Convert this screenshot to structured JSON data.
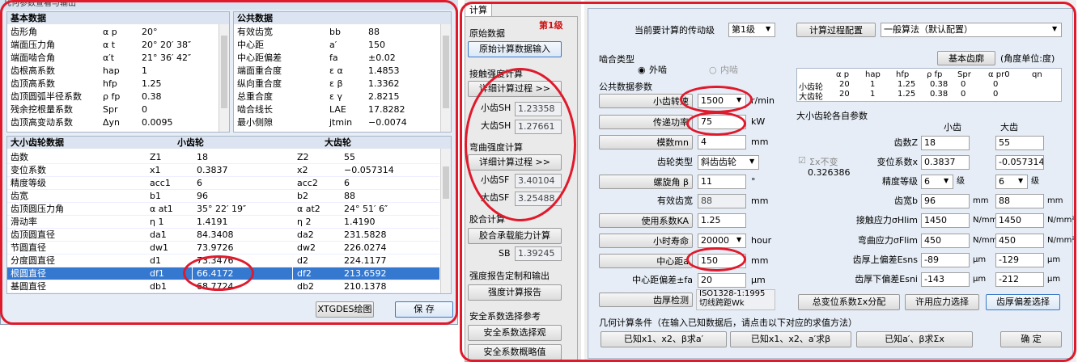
{
  "win1": {
    "title": "几何参数查看与输出",
    "basic_header": "基本数据",
    "public_header": "公共数据",
    "basic": [
      [
        "齿形角",
        "α p",
        "20°"
      ],
      [
        "端面压力角",
        "α t",
        "20° 20′ 38″"
      ],
      [
        "端面啮合角",
        "α′t",
        "21° 36′ 42″"
      ],
      [
        "齿根高系数",
        "hap",
        "1"
      ],
      [
        "齿顶高系数",
        "hfp",
        "1.25"
      ],
      [
        "齿顶圆弧半径系数",
        "ρ fp",
        "0.38"
      ],
      [
        "残余挖根量系数",
        "Spr",
        "0"
      ],
      [
        "齿顶高变动系数",
        "Δyn",
        "0.0095"
      ]
    ],
    "public": [
      [
        "有效齿宽",
        "bb",
        "88"
      ],
      [
        "中心距",
        "a′",
        "150"
      ],
      [
        "中心距偏差",
        "fa",
        "±0.02"
      ],
      [
        "端面重合度",
        "ε α",
        "1.4853"
      ],
      [
        "纵向重合度",
        "ε β",
        "1.3362"
      ],
      [
        "总重合度",
        "ε γ",
        "2.8215"
      ],
      [
        "啮合线长",
        "LAE",
        "17.8282"
      ],
      [
        "最小侧隙",
        "jtmin",
        "−0.0074"
      ]
    ],
    "gear_header": [
      "大小齿轮数据",
      "小齿轮",
      "大齿轮"
    ],
    "gears": [
      [
        "齿数",
        "Z1",
        "18",
        "Z2",
        "55"
      ],
      [
        "变位系数",
        "x1",
        "0.3837",
        "x2",
        "−0.057314"
      ],
      [
        "精度等级",
        "acc1",
        "6",
        "acc2",
        "6"
      ],
      [
        "齿宽",
        "b1",
        "96",
        "b2",
        "88"
      ],
      [
        "齿顶圆压力角",
        "α at1",
        "35° 22′ 19″",
        "α at2",
        "24° 51′ 6″"
      ],
      [
        "滑动率",
        "η 1",
        "1.4191",
        "η 2",
        "1.4190"
      ],
      [
        "齿顶圆直径",
        "da1",
        "84.3408",
        "da2",
        "231.5828"
      ],
      [
        "节圆直径",
        "dw1",
        "73.9726",
        "dw2",
        "226.0274"
      ],
      [
        "分度圆直径",
        "d1",
        "73.3476",
        "d2",
        "224.1177"
      ],
      [
        "根圆直径",
        "df1",
        "66.4172",
        "df2",
        "213.6592"
      ],
      [
        "基圆直径",
        "db1",
        "68.7724",
        "db2",
        "210.1378"
      ]
    ],
    "btn_xtg": "XTGDES绘图",
    "btn_save": "保  存"
  },
  "win2": {
    "tab": "计算",
    "level_tag": "第1级",
    "orig_label": "原始数据",
    "orig_btn": "原始计算数据输入",
    "contact_label": "接触强度计算",
    "detail_btn": "详细计算过程  >>",
    "sh1_label": "小齿SH",
    "sh1": "1.23358",
    "sh2_label": "大齿SH",
    "sh2": "1.27661",
    "bend_label": "弯曲强度计算",
    "detail_btn2": "详细计算过程  >>",
    "sf1_label": "小齿SF",
    "sf1": "3.40104",
    "sf2_label": "大齿SF",
    "sf2": "3.25488",
    "glue_label": "胶合计算",
    "glue_btn": "胶合承载能力计算",
    "sb_label": "SB",
    "sb": "1.39245",
    "report_label": "强度报告定制和输出",
    "report_btn": "强度计算报告",
    "safety_label": "安全系数选择参考",
    "safety_btn1": "安全系数选择观",
    "safety_btn2": "安全系数概略值"
  },
  "win3": {
    "stage_label": "当前要计算的传动级",
    "stage": "第1级",
    "cfg_btn": "计算过程配置",
    "algo": "一般算法（默认配置）",
    "mesh_type": "啮合类型",
    "ext": "外啮",
    "int": "内啮",
    "basic_profile_btn": "基本齿廓",
    "angle_unit": "(角度单位:度)",
    "profile_head": [
      "α p",
      "hap",
      "hfp",
      "ρ fp",
      "Spr",
      "α pr0",
      "qn"
    ],
    "profile_rows": [
      [
        "小齿轮",
        "20",
        "1",
        "1.25",
        "0.38",
        "0",
        "0"
      ],
      [
        "大齿轮",
        "20",
        "1",
        "1.25",
        "0.38",
        "0",
        "0"
      ]
    ],
    "common_label": "公共数据参数",
    "speed_btn": "小齿转速",
    "speed": "1500",
    "speed_unit": "r/min",
    "power_btn": "传递功率",
    "power": "75",
    "power_unit": "kW",
    "module_btn": "模数mn",
    "module": "4",
    "module_unit": "mm",
    "gear_type_label": "齿轮类型",
    "gear_type": "斜齿齿轮",
    "helix_btn": "螺旋角 β",
    "helix": "11",
    "helix_unit": "°",
    "eff_width_label": "有效齿宽",
    "eff_width": "88",
    "eff_width_unit": "mm",
    "ka_btn": "使用系数KA",
    "ka": "1.25",
    "life_btn": "小时寿命",
    "life": "20000",
    "life_unit": "hour",
    "center_btn": "中心距a",
    "center": "150",
    "center_unit": "mm",
    "center_dev_label": "中心距偏差±fa",
    "center_dev": "20",
    "center_dev_unit": "μm",
    "thick_btn": "齿厚检测",
    "thick_std": "ISO1328-1:1995",
    "thick_method": "切线跨距Wk",
    "each_label": "大小齿轮各自参数",
    "small": "小齿",
    "large": "大齿",
    "sumx_label": "Σx不变",
    "sumx_val": "0.326386",
    "z_label": "齿数Z",
    "z1": "18",
    "z2": "55",
    "x_label": "变位系数x",
    "x1": "0.3837",
    "x2": "-0.057314",
    "acc_label": "精度等级",
    "acc1": "6",
    "acc2": "6",
    "level_unit": "级",
    "b_label": "齿宽b",
    "b1": "96",
    "b2": "88",
    "mm": "mm",
    "hlim_label": "接触应力σHlim",
    "hlim1": "1450",
    "hlim2": "1450",
    "mpa": "N/mm²",
    "flim_label": "弯曲应力σFlim",
    "flim1": "450",
    "flim2": "450",
    "esns_label": "齿厚上偏差Esns",
    "esns1": "-89",
    "esns2": "-129",
    "um": "μm",
    "esni_label": "齿厚下偏差Esni",
    "esni1": "-143",
    "esni2": "-212",
    "btn_sumx": "总变位系数Σx分配",
    "btn_allow": "许用应力选择",
    "btn_thickdev": "齿厚偏差选择",
    "cond_label": "几何计算条件（在输入已知数据后，请点击以下对应的求值方法）",
    "btn_c1": "已知x1、x2、β求a′",
    "btn_c2": "已知x1、x2、a′求β",
    "btn_c3": "已知a′、β求Σx",
    "btn_ok": "确  定"
  }
}
